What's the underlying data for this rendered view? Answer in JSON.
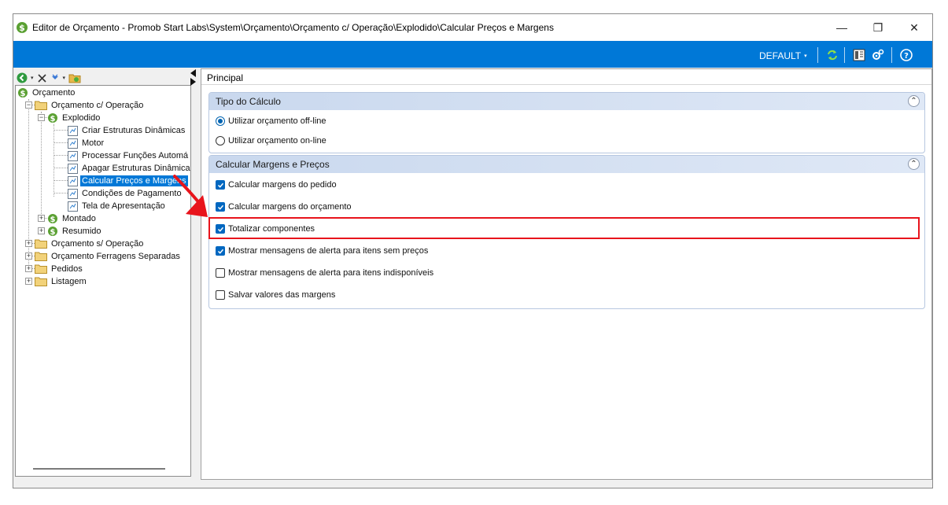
{
  "window": {
    "title": "Editor de Orçamento - Promob Start Labs\\System\\Orçamento\\Orçamento c/ Operação\\Explodido\\Calcular Preços e Margens",
    "controls": {
      "minimize": "—",
      "restore": "❐",
      "close": "✕"
    }
  },
  "toolbar": {
    "profile": "DEFAULT",
    "profile_caret": "▾"
  },
  "nav": {
    "back_caret": "▾",
    "forward_caret": "▾"
  },
  "tree": {
    "items": [
      {
        "label": "Orçamento"
      },
      {
        "label": "Orçamento c/ Operação"
      },
      {
        "label": "Explodido"
      },
      {
        "label": "Criar Estruturas Dinâmicas"
      },
      {
        "label": "Motor"
      },
      {
        "label": "Processar Funções Automá"
      },
      {
        "label": "Apagar Estruturas Dinâmica"
      },
      {
        "label": "Calcular Preços e Margens"
      },
      {
        "label": "Condições de Pagamento"
      },
      {
        "label": "Tela de Apresentação"
      },
      {
        "label": "Montado"
      },
      {
        "label": "Resumido"
      },
      {
        "label": "Orçamento s/ Operação"
      },
      {
        "label": "Orçamento Ferragens Separadas"
      },
      {
        "label": "Pedidos"
      },
      {
        "label": "Listagem"
      }
    ]
  },
  "main": {
    "breadcrumb": "Principal",
    "group1": {
      "title": "Tipo do Cálculo",
      "options": [
        {
          "label": "Utilizar orçamento off-line",
          "selected": true
        },
        {
          "label": "Utilizar orçamento on-line",
          "selected": false
        }
      ]
    },
    "group2": {
      "title": "Calcular Margens e Preços",
      "options": [
        {
          "label": "Calcular margens do pedido",
          "checked": true
        },
        {
          "label": "Calcular margens do orçamento",
          "checked": true
        },
        {
          "label": "Totalizar componentes",
          "checked": true
        },
        {
          "label": "Mostrar mensagens de alerta para itens sem preços",
          "checked": true
        },
        {
          "label": "Mostrar mensagens de alerta para itens indisponíveis",
          "checked": false
        },
        {
          "label": "Salvar valores das margens",
          "checked": false
        }
      ]
    },
    "collapse_glyph": "⌃"
  },
  "colors": {
    "accent": "#0078d7",
    "highlight": "#e8141c",
    "group_header": "#c9d8ee"
  }
}
